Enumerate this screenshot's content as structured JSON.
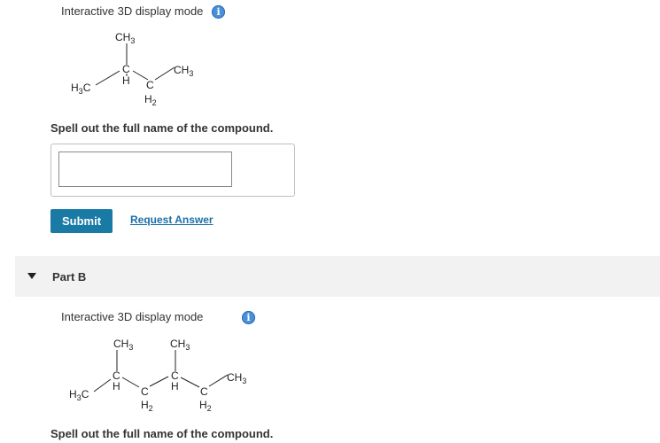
{
  "part_a": {
    "display_mode_label": "Interactive 3D display mode",
    "structure": {
      "ch3_top": "CH3",
      "ch3_right": "CH3",
      "h3c_left": "H3C",
      "c_center": "C",
      "h_center": "H",
      "c_ch2": "C",
      "h2_ch2": "H2"
    },
    "prompt": "Spell out the full name of the compound.",
    "answer_value": "",
    "submit_label": "Submit",
    "request_answer_label": "Request Answer"
  },
  "part_b": {
    "title": "Part B",
    "display_mode_label": "Interactive 3D display mode",
    "structure": {
      "ch3_top1": "CH3",
      "ch3_top2": "CH3",
      "ch3_right": "CH3",
      "h3c_left": "H3C",
      "c1": "C",
      "h1": "H",
      "c2": "C",
      "h2_1": "H2",
      "c3": "C",
      "h3": "H",
      "c4": "C",
      "h2_2": "H2"
    },
    "prompt": "Spell out the full name of the compound."
  },
  "colors": {
    "submit_bg": "#1a7aa6",
    "link": "#1a6fa8",
    "info_icon": "#4a90d9",
    "part_bar": "#f2f2f2"
  },
  "icons": [
    "info-icon",
    "collapse-triangle-icon"
  ]
}
